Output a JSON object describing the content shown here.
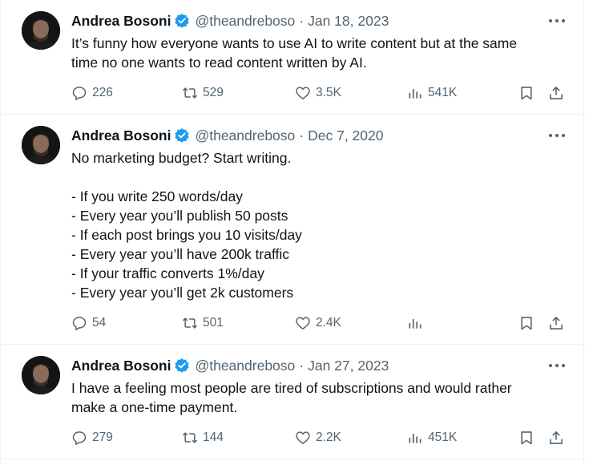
{
  "tweets": [
    {
      "author": "Andrea Bosoni",
      "handle": "@theandreboso",
      "separator": "·",
      "date": "Jan 18, 2023",
      "lines": [
        "It’s funny how everyone wants to use AI to write content but at the same",
        "time no one wants to read content written by AI."
      ],
      "replies": "226",
      "retweets": "529",
      "likes": "3.5K",
      "views": "541K"
    },
    {
      "author": "Andrea Bosoni",
      "handle": "@theandreboso",
      "separator": "·",
      "date": "Dec 7, 2020",
      "lines": [
        "No marketing budget? Start writing.",
        "",
        "- If you write 250 words/day",
        "- Every year you’ll publish 50 posts",
        "- If each post brings you 10 visits/day",
        "- Every year you’ll have 200k traffic",
        "- If your traffic converts 1%/day",
        "- Every year you’ll get 2k customers"
      ],
      "replies": "54",
      "retweets": "501",
      "likes": "2.4K",
      "views": ""
    },
    {
      "author": "Andrea Bosoni",
      "handle": "@theandreboso",
      "separator": "·",
      "date": "Jan 27, 2023",
      "lines": [
        "I have a feeling most people are tired of subscriptions and would rather",
        "make a one-time payment."
      ],
      "replies": "279",
      "retweets": "144",
      "likes": "2.2K",
      "views": "451K"
    }
  ],
  "colors": {
    "text": "#0f1419",
    "secondary": "#536471",
    "verified": "#1d9bf0",
    "divider": "#eff3f4"
  },
  "icons": [
    "reply-icon",
    "retweet-icon",
    "like-icon",
    "views-icon",
    "bookmark-icon",
    "share-icon",
    "verified-badge-icon",
    "more-options-icon"
  ]
}
